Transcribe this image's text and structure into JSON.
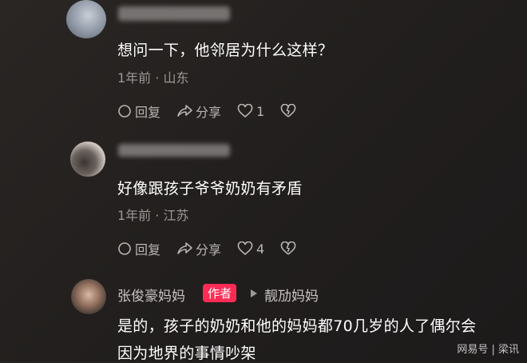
{
  "comments": [
    {
      "text": "想问一下，他邻居为什么这样？",
      "meta": "1年前 · 山东",
      "reply_label": "回复",
      "share_label": "分享",
      "like_count": "1"
    },
    {
      "text": "好像跟孩子爷爷奶奶有矛盾",
      "meta": "1年前 · 江苏",
      "reply_label": "回复",
      "share_label": "分享",
      "like_count": "4"
    },
    {
      "author": "张俊豪妈妈",
      "author_badge": "作者",
      "reply_to": "靓劢妈妈",
      "text_line1": "是的，孩子的奶奶和他的妈妈都70几岁的人了偶尔会",
      "text_line2": "因为地界的事情吵架"
    }
  ],
  "watermark": "网易号 | 梁讯",
  "colors": {
    "badge": "#fe2c55",
    "text": "#ffffff",
    "muted": "#9c9896"
  },
  "icons": [
    "reply-icon",
    "share-icon",
    "heart-icon",
    "broken-heart-icon",
    "triangle-right-icon"
  ]
}
